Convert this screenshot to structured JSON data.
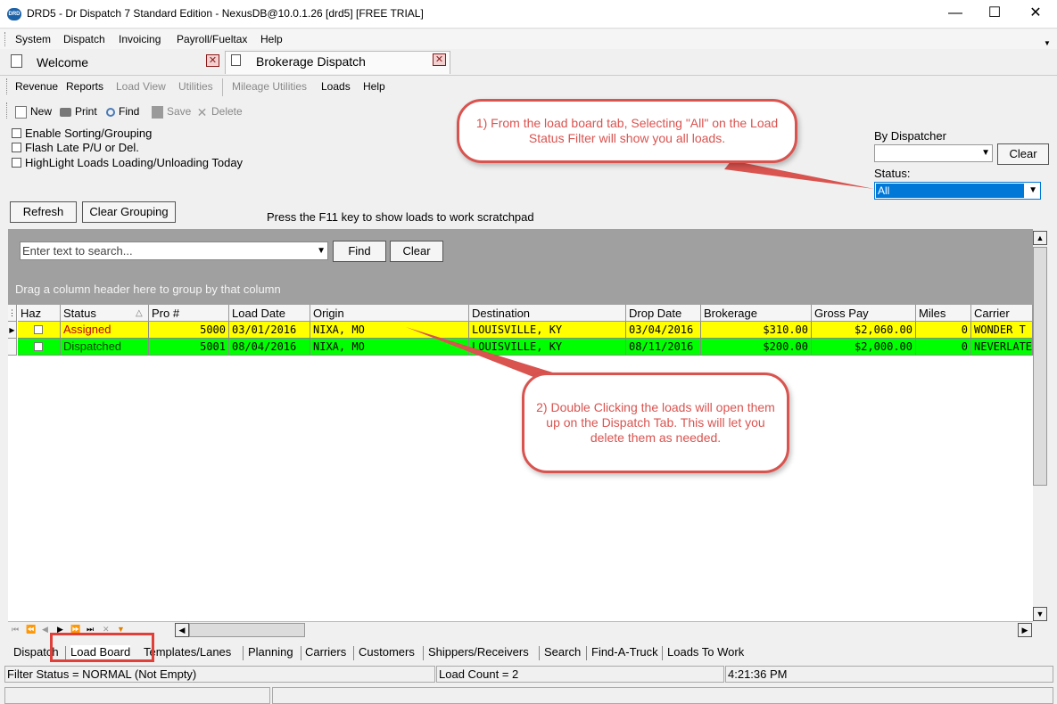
{
  "window": {
    "title": "DRD5 - Dr Dispatch 7 Standard Edition - NexusDB@10.0.1.26 [drd5] [FREE TRIAL]",
    "icon_text": "DRD",
    "minimize_glyph": "—",
    "maximize_glyph": "☐",
    "close_glyph": "✕"
  },
  "menu": [
    "System",
    "Dispatch",
    "Invoicing",
    "Payroll/Fueltax",
    "Help"
  ],
  "menu_arrow": "▼",
  "doc_tabs": [
    {
      "label": "Welcome",
      "close": "✕"
    },
    {
      "label": "Brokerage Dispatch",
      "close": "✕"
    }
  ],
  "submenu": [
    {
      "label": "Revenue",
      "enabled": true
    },
    {
      "label": "Reports",
      "enabled": true
    },
    {
      "label": "Load View",
      "enabled": false
    },
    {
      "label": "Utilities",
      "enabled": false
    },
    {
      "label": "Mileage Utilities",
      "enabled": false
    },
    {
      "label": "Loads",
      "enabled": true
    },
    {
      "label": "Help",
      "enabled": true
    }
  ],
  "toolbar": {
    "new": "New",
    "print": "Print",
    "find": "Find",
    "save": "Save",
    "delete": "Delete"
  },
  "options": {
    "enable_sorting": "Enable Sorting/Grouping",
    "flash_late": "Flash Late P/U or Del.",
    "highlight_loads": "HighLight Loads Loading/Unloading Today"
  },
  "buttons": {
    "refresh": "Refresh",
    "clear_grouping": "Clear Grouping",
    "find": "Find",
    "clear_search": "Clear",
    "clear_dispatcher": "Clear"
  },
  "f11_hint": "Press the F11 key to show loads to work scratchpad",
  "filters": {
    "dispatcher_label": "By Dispatcher",
    "dispatcher_value": "",
    "status_label": "Status:",
    "status_value": "All",
    "combo_arrow": "▼"
  },
  "search": {
    "placeholder": "Enter text to search...",
    "arrow": "▼"
  },
  "group_hint": "Drag a column header here to group by that column",
  "table": {
    "columns": [
      "Haz",
      "Status",
      "Pro #",
      "Load Date",
      "Origin",
      "Destination",
      "Drop Date",
      "Brokerage",
      "Gross Pay",
      "Miles",
      "Carrier"
    ],
    "sort_indicator": "△",
    "rows": [
      {
        "haz": false,
        "status": "Assigned",
        "pro": "5000",
        "load_date": "03/01/2016",
        "origin": "NIXA, MO",
        "destination": "LOUISVILLE, KY",
        "drop_date": "03/04/2016",
        "brokerage": "$310.00",
        "gross_pay": "$2,060.00",
        "miles": "0",
        "carrier": "WONDER T",
        "color": "#ffff00",
        "indicator": "▶"
      },
      {
        "haz": false,
        "status": "Dispatched",
        "pro": "5001",
        "load_date": "08/04/2016",
        "origin": "NIXA, MO",
        "destination": "LOUISVILLE, KY",
        "drop_date": "08/11/2016",
        "brokerage": "$200.00",
        "gross_pay": "$2,000.00",
        "miles": "0",
        "carrier": "NEVERLATE",
        "color": "#00ff00",
        "indicator": ""
      }
    ]
  },
  "nav_glyphs": [
    "⏮",
    "⏪",
    "◀",
    "▶",
    "⏩",
    "⏭",
    "✕",
    "▼"
  ],
  "scroll": {
    "up": "▲",
    "down": "▼",
    "left": "◀",
    "right": "▶"
  },
  "bottom_tabs": [
    "Dispatch",
    "Load Board",
    "Templates/Lanes",
    "Planning",
    "Carriers",
    "Customers",
    "Shippers/Receivers",
    "Search",
    "Find-A-Truck",
    "Loads To Work"
  ],
  "active_bottom_tab": "Load Board",
  "status_bar": {
    "filter_status": "Filter Status = NORMAL (Not Empty)",
    "load_count": "Load Count = 2",
    "time": "4:21:36 PM"
  },
  "callouts": {
    "one": "1) From the load board tab, Selecting \"All\" on the Load Status Filter will show you all loads.",
    "two": "2) Double Clicking the loads will open them up on the Dispatch Tab. This will let you delete them as needed."
  },
  "colors": {
    "callout": "#d9534f",
    "assigned_row": "#ffff00",
    "dispatched_row": "#00ff00",
    "status_selected": "#0078d7"
  }
}
